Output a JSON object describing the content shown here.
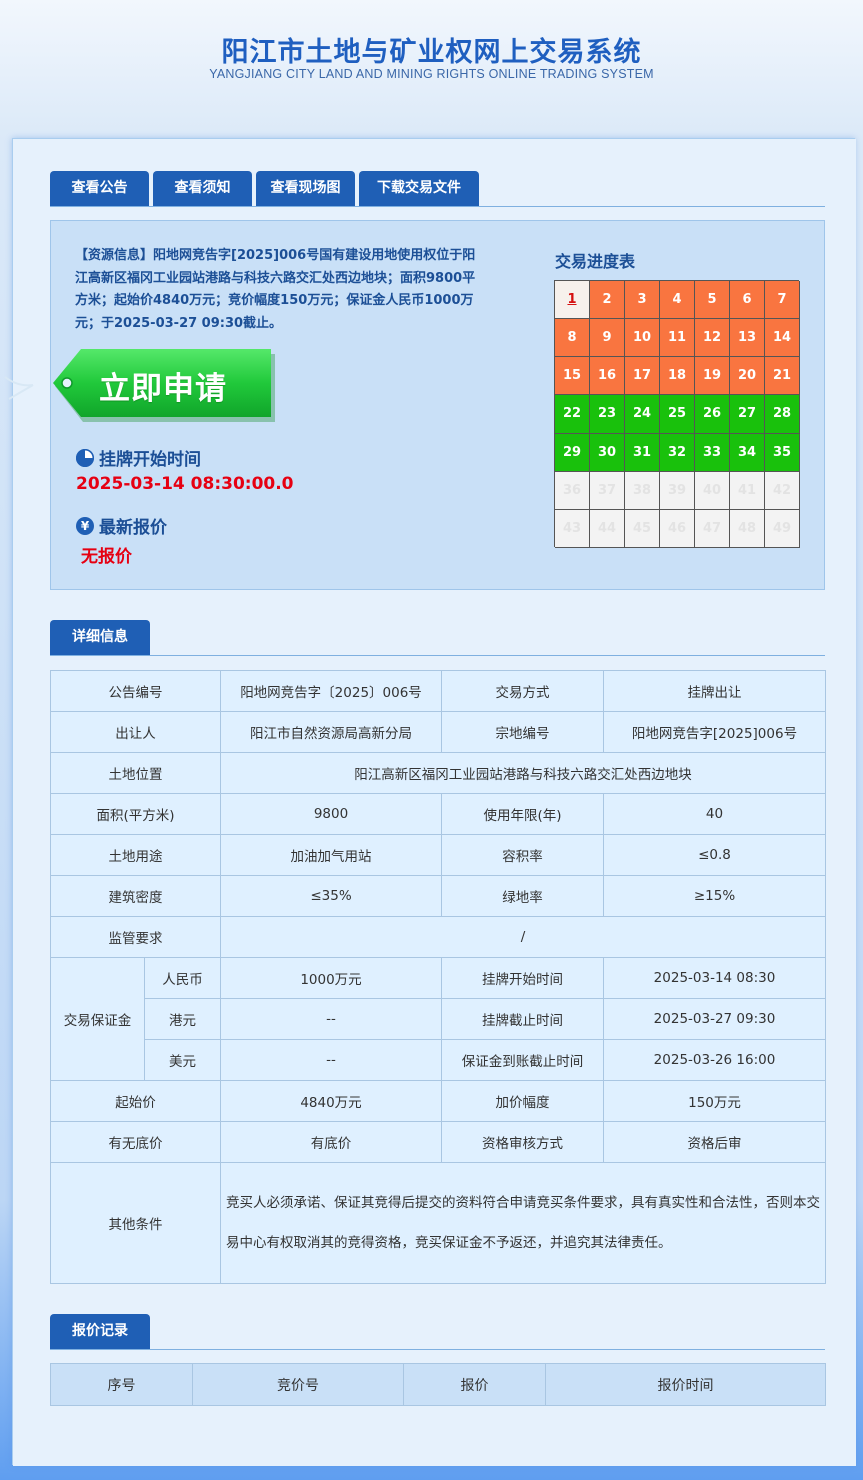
{
  "header": {
    "title": "阳江市土地与矿业权网上交易系统",
    "subtitle": "YANGJIANG CITY LAND AND MINING RIGHTS ONLINE TRADING SYSTEM"
  },
  "tabs": [
    "查看公告",
    "查看须知",
    "查看现场图",
    "下载交易文件"
  ],
  "resource": {
    "text": "【资源信息】阳地网竞告字[2025]006号国有建设用地使用权位于阳江高新区福冈工业园站港路与科技六路交汇处西边地块；面积9800平方米；起始价4840万元；竞价幅度150万元；保证金人民币1000万元；于2025-03-27 09:30截止。",
    "apply_label": "立即申请",
    "listing_start_label": "挂牌开始时间",
    "listing_start_value": "2025-03-14 08:30:00.0",
    "latest_quote_label": "最新报价",
    "latest_quote_value": "无报价",
    "yen_symbol": "¥"
  },
  "progress": {
    "title": "交易进度表",
    "status_colors": {
      "current": "#f7f1ec",
      "done": "#f97540",
      "planned": "#19c10c",
      "future": "#f3f3f3"
    },
    "days": [
      {
        "n": "1",
        "s": "current"
      },
      {
        "n": "2",
        "s": "done"
      },
      {
        "n": "3",
        "s": "done"
      },
      {
        "n": "4",
        "s": "done"
      },
      {
        "n": "5",
        "s": "done"
      },
      {
        "n": "6",
        "s": "done"
      },
      {
        "n": "7",
        "s": "done"
      },
      {
        "n": "8",
        "s": "done"
      },
      {
        "n": "9",
        "s": "done"
      },
      {
        "n": "10",
        "s": "done"
      },
      {
        "n": "11",
        "s": "done"
      },
      {
        "n": "12",
        "s": "done"
      },
      {
        "n": "13",
        "s": "done"
      },
      {
        "n": "14",
        "s": "done"
      },
      {
        "n": "15",
        "s": "done"
      },
      {
        "n": "16",
        "s": "done"
      },
      {
        "n": "17",
        "s": "done"
      },
      {
        "n": "18",
        "s": "done"
      },
      {
        "n": "19",
        "s": "done"
      },
      {
        "n": "20",
        "s": "done"
      },
      {
        "n": "21",
        "s": "done"
      },
      {
        "n": "22",
        "s": "planned"
      },
      {
        "n": "23",
        "s": "planned"
      },
      {
        "n": "24",
        "s": "planned"
      },
      {
        "n": "25",
        "s": "planned"
      },
      {
        "n": "26",
        "s": "planned"
      },
      {
        "n": "27",
        "s": "planned"
      },
      {
        "n": "28",
        "s": "planned"
      },
      {
        "n": "29",
        "s": "planned"
      },
      {
        "n": "30",
        "s": "planned"
      },
      {
        "n": "31",
        "s": "planned"
      },
      {
        "n": "32",
        "s": "planned"
      },
      {
        "n": "33",
        "s": "planned"
      },
      {
        "n": "34",
        "s": "planned"
      },
      {
        "n": "35",
        "s": "planned"
      },
      {
        "n": "36",
        "s": "future"
      },
      {
        "n": "37",
        "s": "future"
      },
      {
        "n": "38",
        "s": "future"
      },
      {
        "n": "39",
        "s": "future"
      },
      {
        "n": "40",
        "s": "future"
      },
      {
        "n": "41",
        "s": "future"
      },
      {
        "n": "42",
        "s": "future"
      },
      {
        "n": "43",
        "s": "future"
      },
      {
        "n": "44",
        "s": "future"
      },
      {
        "n": "45",
        "s": "future"
      },
      {
        "n": "46",
        "s": "future"
      },
      {
        "n": "47",
        "s": "future"
      },
      {
        "n": "48",
        "s": "future"
      },
      {
        "n": "49",
        "s": "future"
      }
    ]
  },
  "detail": {
    "section_title": "详细信息",
    "notice_no_label": "公告编号",
    "notice_no": "阳地网竞告字〔2025〕006号",
    "trade_mode_label": "交易方式",
    "trade_mode": "挂牌出让",
    "seller_label": "出让人",
    "seller": "阳江市自然资源局高新分局",
    "parcel_no_label": "宗地编号",
    "parcel_no": "阳地网竞告字[2025]006号",
    "location_label": "土地位置",
    "location": "阳江高新区福冈工业园站港路与科技六路交汇处西边地块",
    "area_label": "面积(平方米)",
    "area": "9800",
    "years_label": "使用年限(年)",
    "years": "40",
    "usage_label": "土地用途",
    "usage": "加油加气用站",
    "far_label": "容积率",
    "far": "≤0.8",
    "density_label": "建筑密度",
    "density": "≤35%",
    "green_label": "绿地率",
    "green": "≥15%",
    "supervision_label": "监管要求",
    "supervision": "/",
    "deposit_label": "交易保证金",
    "rmb_label": "人民币",
    "rmb": "1000万元",
    "hkd_label": "港元",
    "hkd": "--",
    "usd_label": "美元",
    "usd": "--",
    "list_start_label": "挂牌开始时间",
    "list_start": "2025-03-14 08:30",
    "list_end_label": "挂牌截止时间",
    "list_end": "2025-03-27 09:30",
    "deposit_deadline_label": "保证金到账截止时间",
    "deposit_deadline": "2025-03-26 16:00",
    "start_price_label": "起始价",
    "start_price": "4840万元",
    "increment_label": "加价幅度",
    "increment": "150万元",
    "reserve_label": "有无底价",
    "reserve": "有底价",
    "review_label": "资格审核方式",
    "review": "资格后审",
    "other_label": "其他条件",
    "other": "竞买人必须承诺、保证其竞得后提交的资料符合申请竞买条件要求，具有真实性和合法性，否则本交易中心有权取消其的竞得资格，竞买保证金不予返还，并追究其法律责任。"
  },
  "quotes": {
    "section_title": "报价记录",
    "columns": [
      "序号",
      "竞价号",
      "报价",
      "报价时间"
    ]
  }
}
